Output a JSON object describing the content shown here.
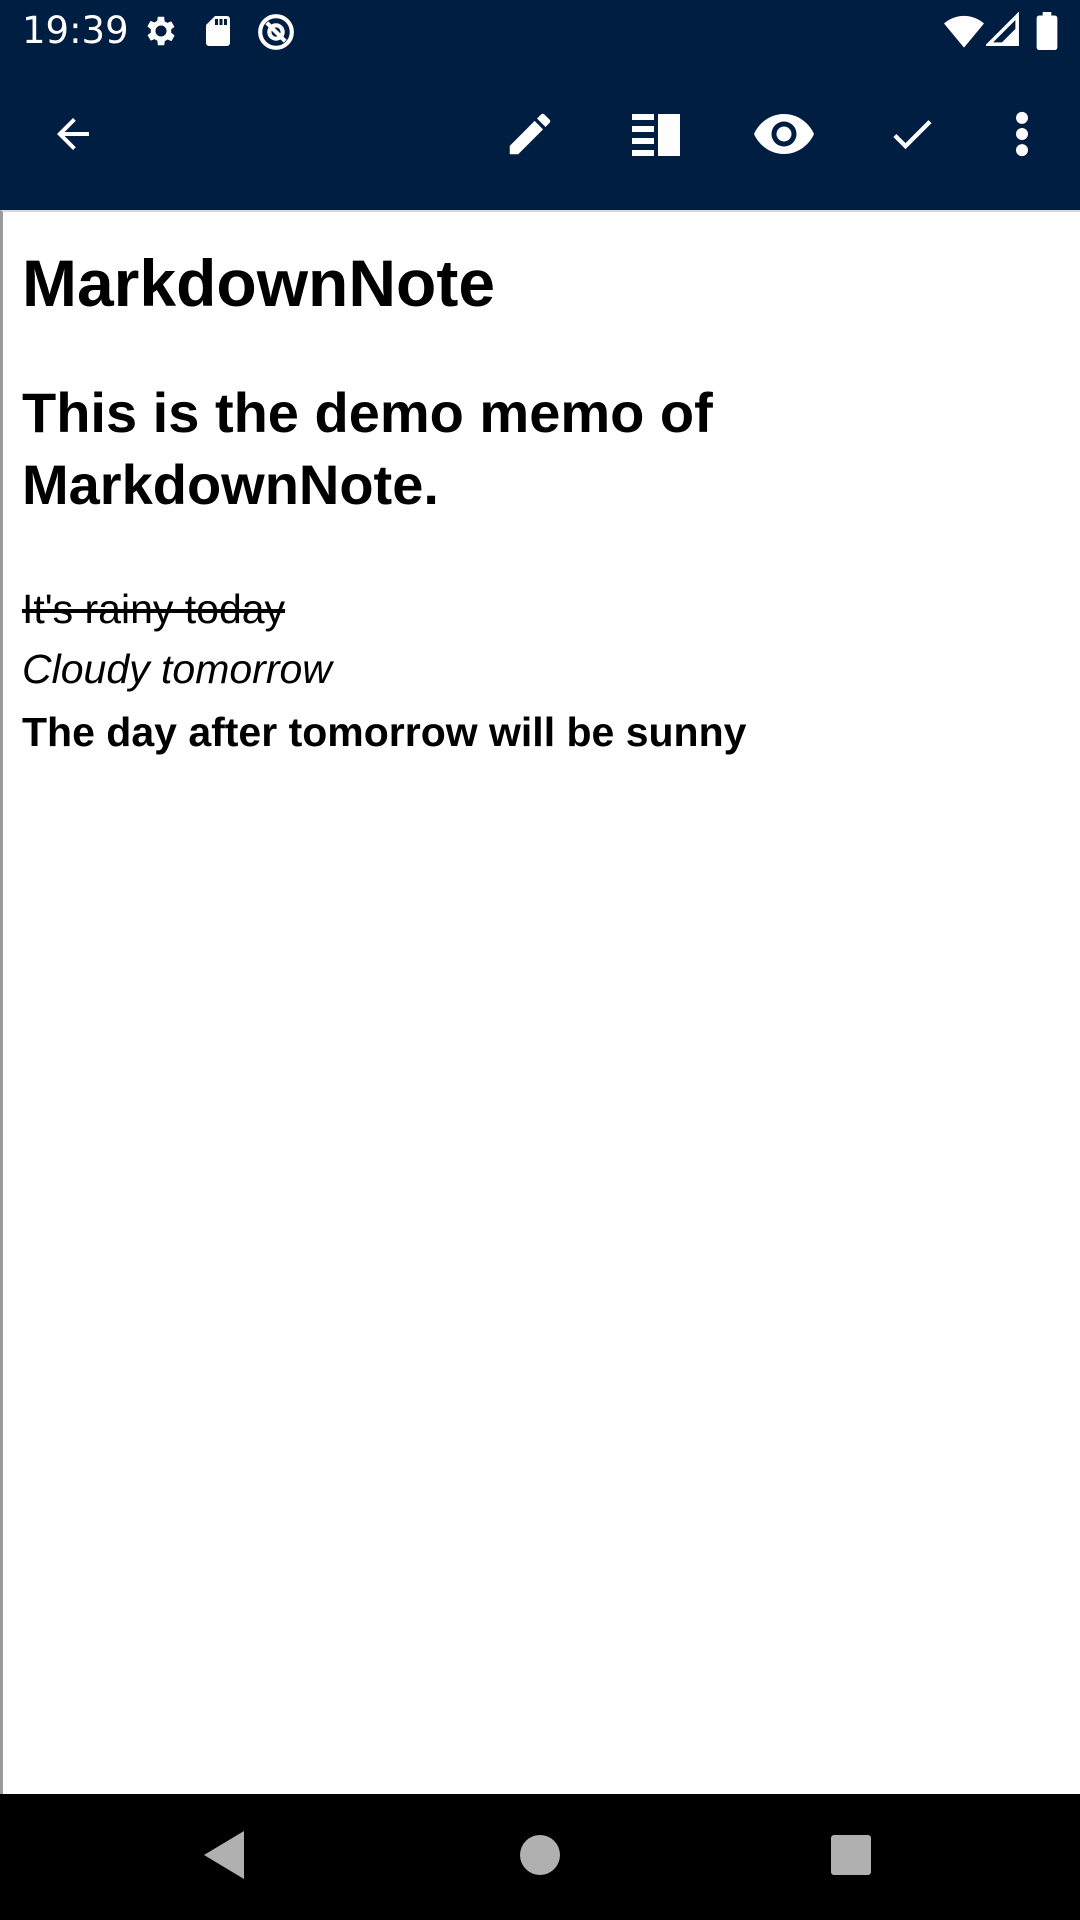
{
  "status_bar": {
    "time": "19:39",
    "left_icons": [
      "settings-icon",
      "sd-card-icon",
      "at-sign-icon"
    ],
    "right_icons": [
      "wifi-icon",
      "signal-icon",
      "battery-icon"
    ]
  },
  "app_bar": {
    "background": "#001d42",
    "actions": [
      "back-arrow-icon",
      "edit-pencil-icon",
      "split-view-icon",
      "preview-eye-icon",
      "check-icon",
      "more-vert-icon"
    ]
  },
  "note": {
    "h1": "MarkdownNote",
    "h2": "This is the demo memo of MarkdownNote.",
    "strikethrough": "It's rainy today",
    "italic": "Cloudy tomorrow",
    "bold": "The day after tomorrow will be sunny"
  },
  "nav_bar": {
    "buttons": [
      "nav-back-icon",
      "nav-home-icon",
      "nav-recents-icon"
    ]
  }
}
